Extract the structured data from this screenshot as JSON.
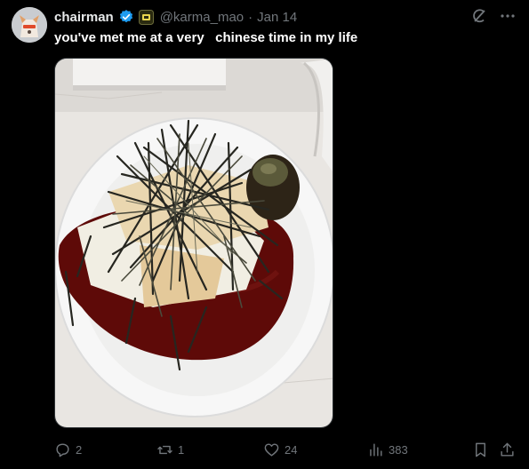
{
  "author": {
    "display_name": "chairman",
    "handle": "@karma_mao",
    "separator": "·",
    "date": "Jan 14",
    "verified": true
  },
  "tweet": {
    "text": "you've met me at a very   chinese time in my life"
  },
  "media": {
    "icon": "food-photo",
    "subject": "silken tofu topped with shredded seaweed in soy sauce with a century egg on a white plate"
  },
  "actions": {
    "replies": "2",
    "retweets": "1",
    "likes": "24",
    "views": "383"
  },
  "colors": {
    "background": "#000000",
    "text": "#e7e9ea",
    "muted": "#71767b",
    "verified_blue": "#1d9bf0"
  }
}
